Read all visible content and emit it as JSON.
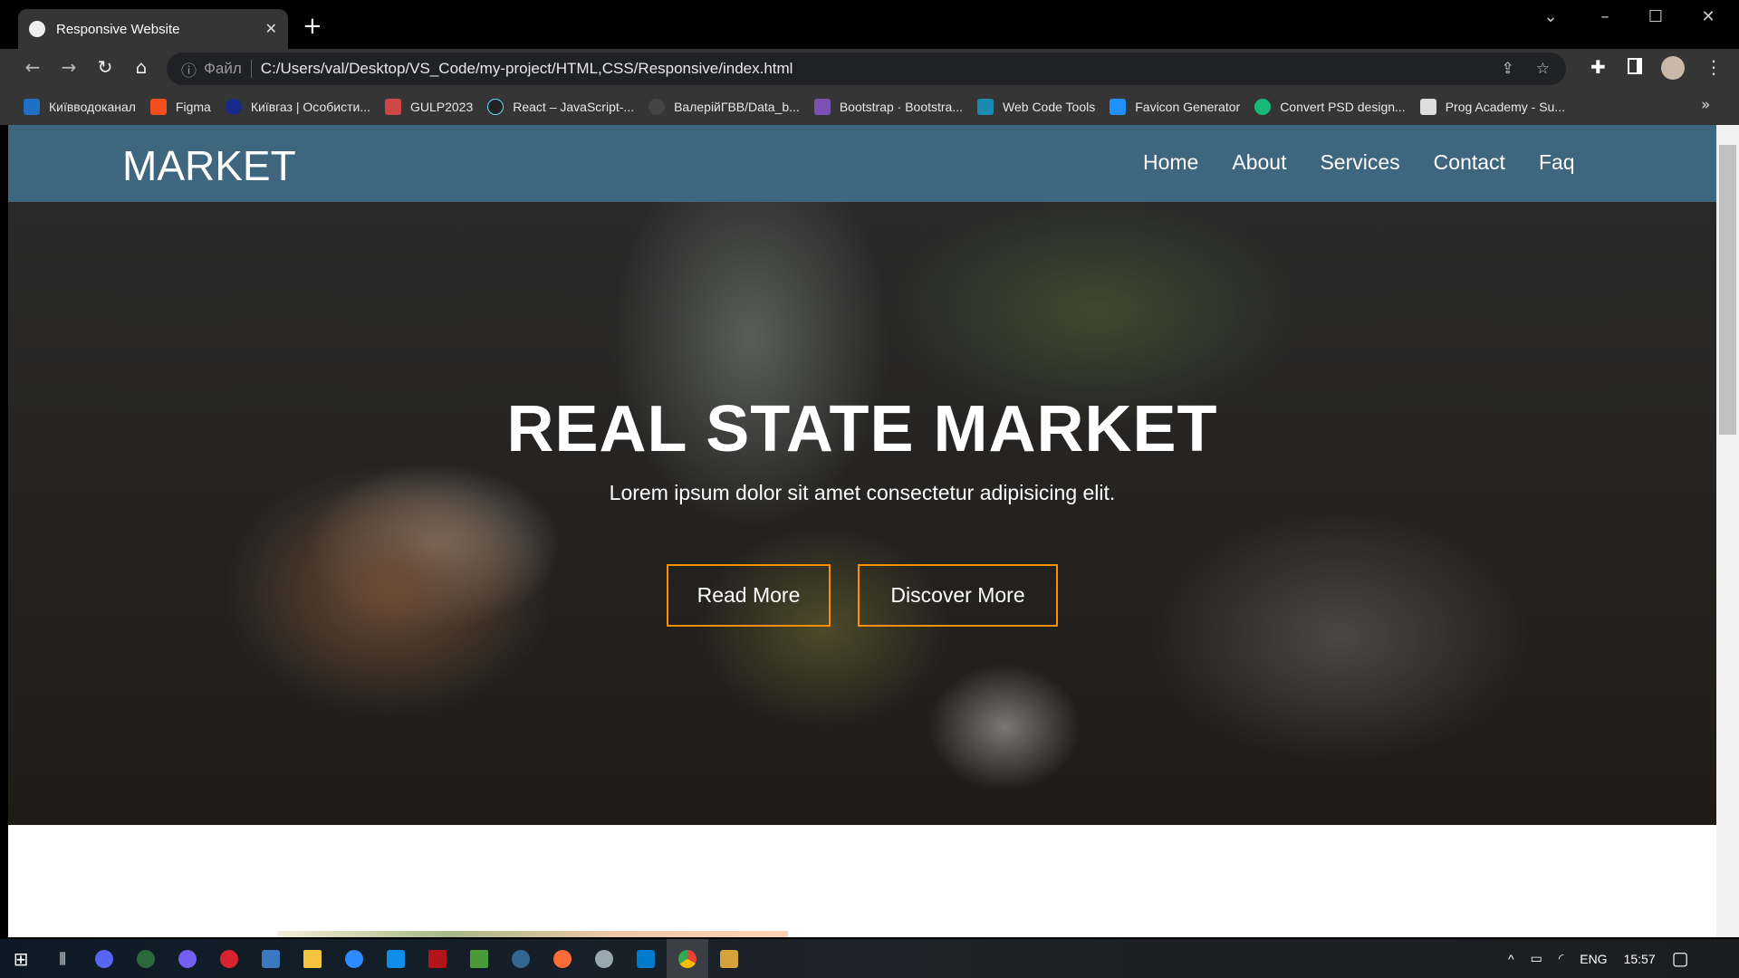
{
  "browser": {
    "tab_title": "Responsive Website",
    "new_tab": "+",
    "url_scheme": "Файл",
    "url": "C:/Users/val/Desktop/VS_Code/my-project/HTML,CSS/Responsive/index.html",
    "bookmarks": [
      {
        "label": "Київводоканал",
        "color": "#1f6fc4"
      },
      {
        "label": "Figma",
        "color": "#f24e1e"
      },
      {
        "label": "Київгаз | Особисти...",
        "color": "#1a2a8a"
      },
      {
        "label": "GULP2023",
        "color": "#cf4647"
      },
      {
        "label": "React – JavaScript-...",
        "color": "#61dafb"
      },
      {
        "label": "ВалерійГВВ/Data_b...",
        "color": "#444444"
      },
      {
        "label": "Bootstrap · Bootstra...",
        "color": "#7952b3"
      },
      {
        "label": "Web Code Tools",
        "color": "#1a8ab0"
      },
      {
        "label": "Favicon Generator",
        "color": "#1e90ff"
      },
      {
        "label": "Convert PSD design...",
        "color": "#18b87a"
      },
      {
        "label": "Prog Academy  - Su...",
        "color": "#dddddd"
      }
    ],
    "bookmarks_more": "»"
  },
  "site": {
    "logo": "MARKET",
    "nav": [
      "Home",
      "About",
      "Services",
      "Contact",
      "Faq"
    ],
    "hero_title": "REAL STATE MARKET",
    "hero_subtitle": "Lorem ipsum dolor sit amet consectetur adipisicing elit.",
    "buttons": [
      "Read More",
      "Discover More"
    ],
    "colors": {
      "nav": "#3e667e",
      "button_border": "#ff9100"
    }
  },
  "taskbar": {
    "apps": [
      "start",
      "task-view",
      "discord",
      "app",
      "viber",
      "opera",
      "shield",
      "file-explorer",
      "messenger",
      "teamviewer",
      "pdf",
      "terminal",
      "postgres",
      "postman",
      "app",
      "vscode",
      "chrome",
      "app"
    ],
    "language": "ENG",
    "time": "15:57"
  }
}
